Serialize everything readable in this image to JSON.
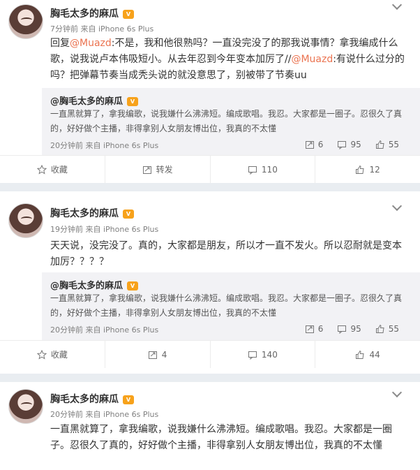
{
  "posts": [
    {
      "author": "胸毛太多的麻瓜",
      "meta": "7分钟前 来自 iPhone 6s Plus",
      "text_parts": [
        "回复",
        "@Muazd",
        ":不是，我和他很熟吗？一直没完没了的那我说事情？拿我编成什么歌，说我说卢本伟吸短小。从去年忍到今年变本加厉了//",
        "@Muazd",
        ":有说什么过分的吗？把弹幕节奏当成秃头说的就没意思了，别被带了节奏uu"
      ],
      "quote": {
        "author": "@胸毛太多的麻瓜",
        "text": "一直黑就算了，拿我编歌，说我嫌什么沸沸短。编成歌唱。我忍。大家都是一圈子。忍很久了真的，好好做个主播，非得拿别人女朋友博出位，我真的不太懂",
        "meta": "20分钟前 来自 iPhone 6s Plus",
        "reposts": "6",
        "comments": "95",
        "likes": "55"
      },
      "actions": {
        "favorite": "收藏",
        "repost": "转发",
        "comment": "110",
        "like": "12"
      }
    },
    {
      "author": "胸毛太多的麻瓜",
      "meta": "19分钟前 来自 iPhone 6s Plus",
      "text": "天天说，没完没了。真的，大家都是朋友，所以才一直不发火。所以忍耐就是变本加厉？？？？",
      "quote": {
        "author": "@胸毛太多的麻瓜",
        "text": "一直黑就算了，拿我编歌，说我嫌什么沸沸短。编成歌唱。我忍。大家都是一圈子。忍很久了真的，好好做个主播，非得拿别人女朋友博出位，我真的不太懂",
        "meta": "20分钟前 来自 iPhone 6s Plus",
        "reposts": "6",
        "comments": "95",
        "likes": "55"
      },
      "actions": {
        "favorite": "收藏",
        "repost": "4",
        "comment": "140",
        "like": "44"
      }
    },
    {
      "author": "胸毛太多的麻瓜",
      "meta": "20分钟前 来自 iPhone 6s Plus",
      "text": "一直黑就算了，拿我编歌，说我嫌什么沸沸短。编成歌唱。我忍。大家都是一圈子。忍很久了真的，好好做个主播，非得拿别人女朋友博出位，我真的不太懂"
    }
  ],
  "icons": {
    "vip": "vip-badge-icon",
    "menu": "chevron-down-icon",
    "favorite": "star-icon",
    "repost": "repost-icon",
    "comment": "comment-icon",
    "like": "thumbs-up-icon"
  },
  "colors": {
    "link": "#eb7350",
    "vip": "#f7a21b",
    "background": "#e9edf1"
  }
}
